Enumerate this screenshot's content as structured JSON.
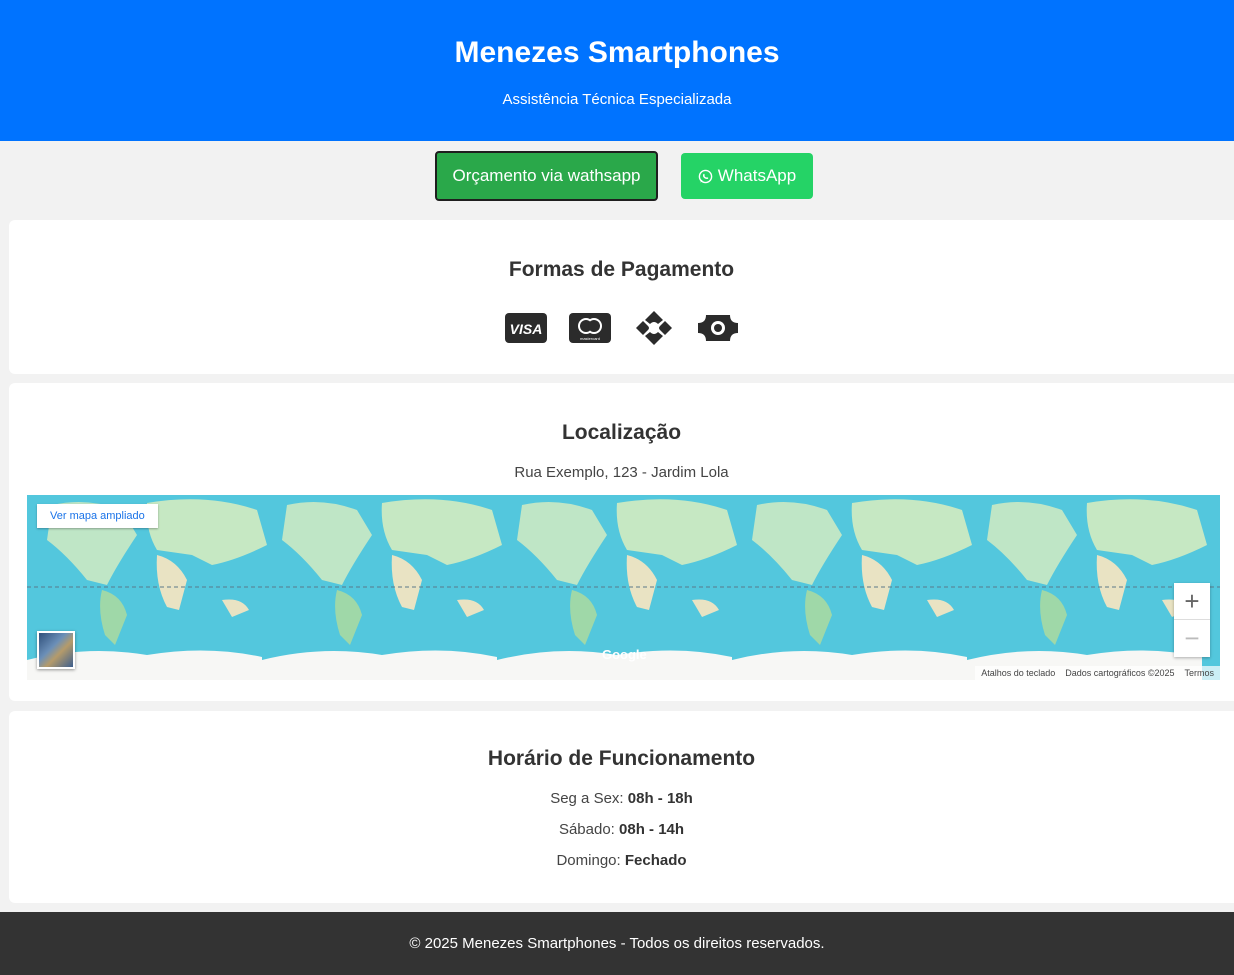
{
  "header": {
    "title": "Menezes Smartphones",
    "subtitle": "Assistência Técnica Especializada"
  },
  "actions": {
    "quote_label": "Orçamento via wathsapp",
    "whatsapp_label": "WhatsApp",
    "quote_color": "#2aa84a",
    "whatsapp_color": "#25d366"
  },
  "payment": {
    "title": "Formas de Pagamento",
    "methods": [
      {
        "icon": "visa-icon",
        "label": "VISA"
      },
      {
        "icon": "mastercard-icon",
        "label": "mastercard"
      },
      {
        "icon": "pix-icon"
      },
      {
        "icon": "cash-icon"
      }
    ]
  },
  "location": {
    "title": "Localização",
    "address": "Rua Exemplo, 123 - Jardim Lola",
    "map": {
      "expand_label": "Ver mapa ampliado",
      "zoom_in": "+",
      "zoom_out": "−",
      "logo": "Google",
      "shortcuts": "Atalhos do teclado",
      "map_data": "Dados cartográficos ©2025",
      "terms": "Termos"
    }
  },
  "hours": {
    "title": "Horário de Funcionamento",
    "rows": [
      {
        "label": "Seg a Sex:",
        "value": "08h - 18h"
      },
      {
        "label": "Sábado:",
        "value": "08h - 14h"
      },
      {
        "label": "Domingo:",
        "value": "Fechado"
      }
    ]
  },
  "footer": {
    "text": "© 2025 Menezes Smartphones - Todos os direitos reservados."
  },
  "colors": {
    "primary": "#0073ff",
    "background": "#f2f2f2",
    "footer": "#333333"
  }
}
